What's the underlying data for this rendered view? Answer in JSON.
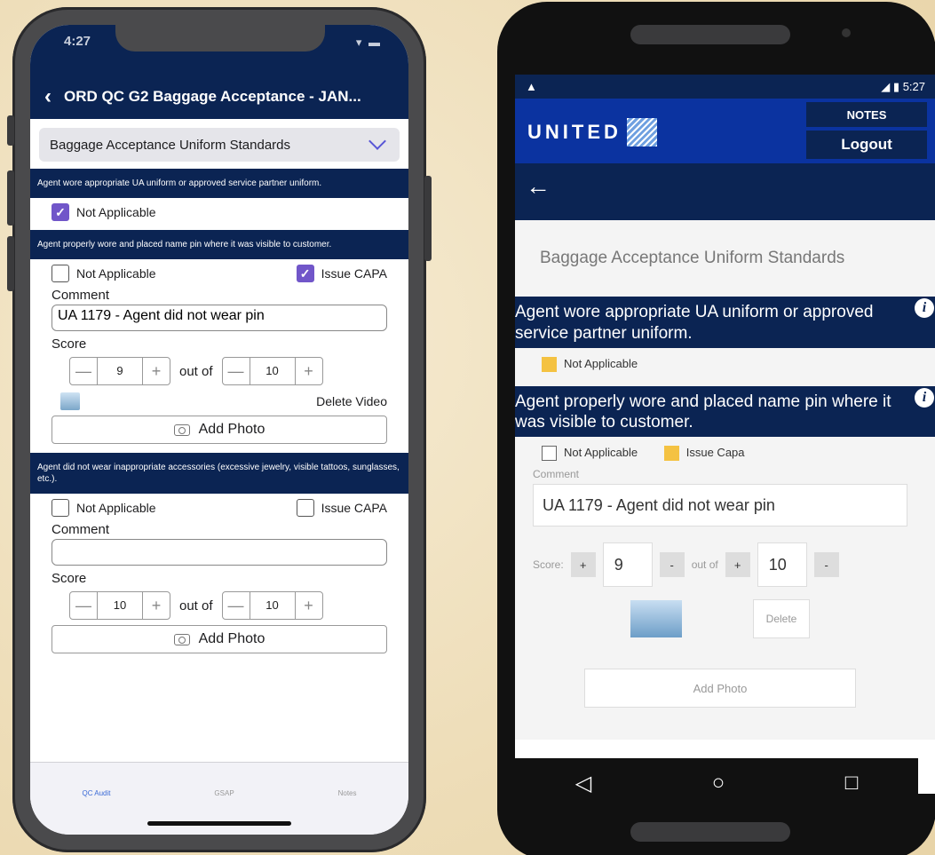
{
  "ios": {
    "status_time": "4:27",
    "nav_title": "ORD QC G2 Baggage Acceptance - JAN...",
    "select_value": "Baggage Acceptance Uniform Standards",
    "q1": {
      "text": "Agent wore appropriate UA uniform or approved service partner uniform.",
      "na_label": "Not Applicable",
      "na_checked": true
    },
    "q2": {
      "text": "Agent properly wore and placed name pin where it was visible to customer.",
      "na_label": "Not Applicable",
      "capa_label": "Issue CAPA",
      "comment_label": "Comment",
      "comment_value": "UA 1179 - Agent did not wear pin",
      "score_label": "Score",
      "score": "9",
      "out_of_label": "out of",
      "max": "10",
      "delete_video": "Delete Video",
      "add_photo": "Add Photo"
    },
    "q3": {
      "text": "Agent did not wear inappropriate accessories (excessive jewelry, visible tattoos, sunglasses, etc.).",
      "na_label": "Not Applicable",
      "capa_label": "Issue CAPA",
      "comment_label": "Comment",
      "comment_value": "",
      "score_label": "Score",
      "score": "10",
      "out_of_label": "out of",
      "max": "10",
      "add_photo": "Add Photo"
    },
    "tabs": [
      "QC Audit",
      "GSAP",
      "Notes"
    ]
  },
  "android": {
    "status_time": "5:27",
    "logo": "UNITED",
    "notes": "NOTES",
    "logout": "Logout",
    "select_value": "Baggage Acceptance Uniform Standards",
    "q1": {
      "text": "Agent wore appropriate UA uniform or approved service partner uniform.",
      "na_label": "Not Applicable"
    },
    "q2": {
      "text": "Agent properly wore and placed name pin where it was visible to customer.",
      "na_label": "Not Applicable",
      "capa_label": "Issue Capa",
      "comment_label": "Comment",
      "comment_value": "UA 1179 - Agent did not wear pin",
      "score_label": "Score:",
      "score": "9",
      "out_of_label": "out of",
      "max": "10",
      "plus": "+",
      "minus": "-",
      "delete": "Delete",
      "add_photo": "Add Photo"
    }
  },
  "icons": {
    "ios_back": "back-chevron-icon",
    "ios_dropdown": "chevron-down-icon",
    "camera": "camera-icon",
    "android_back": "arrow-left-icon",
    "info": "info-icon",
    "nav_back": "triangle-back-icon",
    "nav_home": "circle-home-icon",
    "nav_recents": "square-recents-icon"
  },
  "colors": {
    "navy": "#0b2453",
    "united_blue": "#0b33a0",
    "ios_check": "#7156c9",
    "android_check": "#f4c242",
    "background": "#f0e3c4"
  }
}
